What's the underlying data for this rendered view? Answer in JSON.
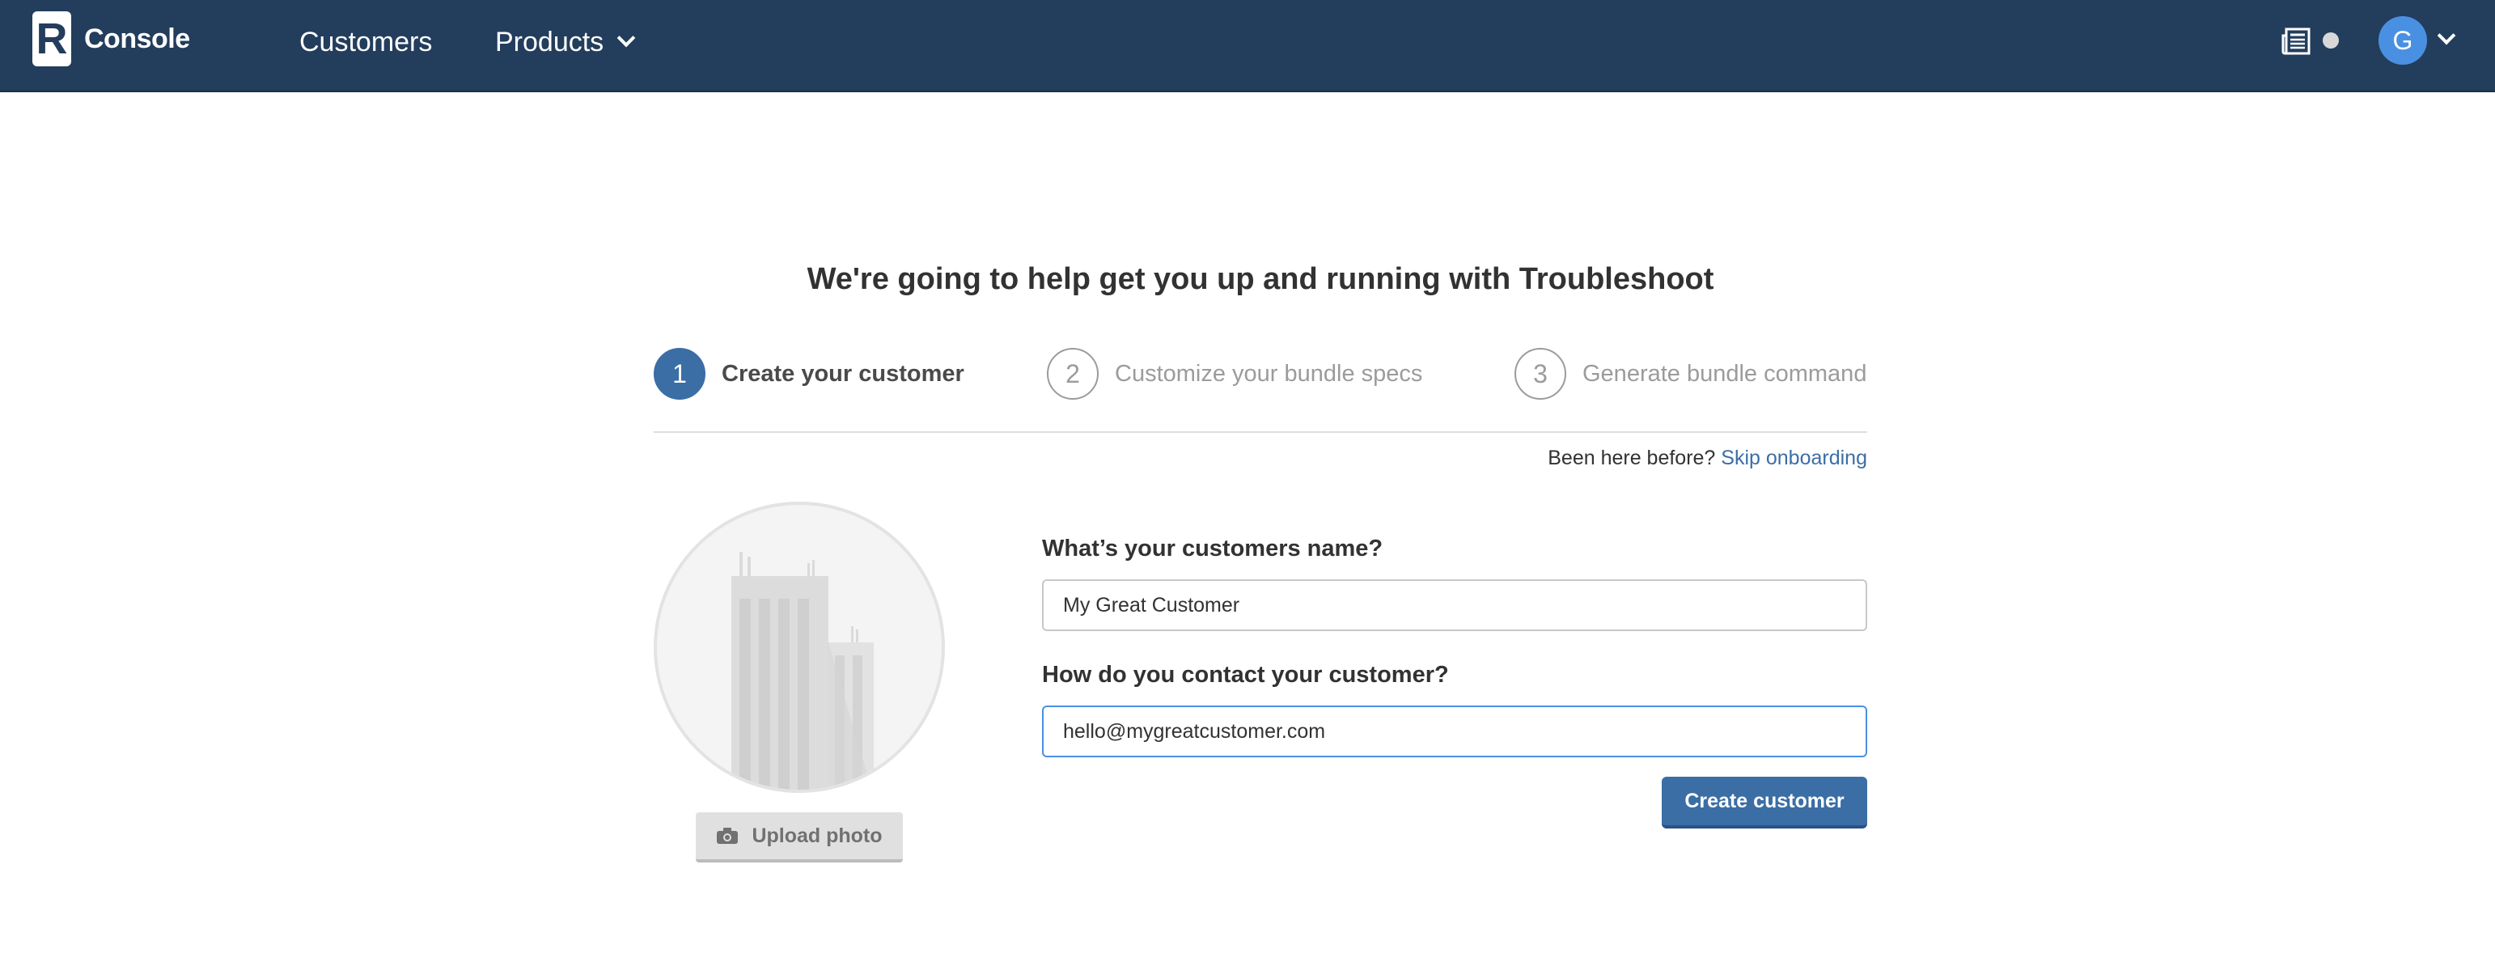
{
  "nav": {
    "brand_letter": "R",
    "brand_name": "Console",
    "customers_label": "Customers",
    "products_label": "Products",
    "avatar_initial": "G",
    "icons": {
      "news": "newspaper-icon",
      "dropdown": "chevron-down-icon"
    }
  },
  "onboarding": {
    "title": "We're going to help get you up and running with Troubleshoot",
    "steps": [
      {
        "number": "1",
        "label": "Create your customer",
        "active": true
      },
      {
        "number": "2",
        "label": "Customize your bundle specs",
        "active": false
      },
      {
        "number": "3",
        "label": "Generate bundle command",
        "active": false
      }
    ],
    "skip_prompt": "Been here before?",
    "skip_link": "Skip onboarding"
  },
  "form": {
    "name_label": "What’s your customers name?",
    "name_value": "My Great Customer",
    "contact_label": "How do you contact your customer?",
    "contact_value": "hello@mygreatcustomer.com",
    "upload_label": "Upload photo",
    "submit_label": "Create customer"
  },
  "colors": {
    "nav_bg": "#233d5c",
    "accent": "#3b6ea5",
    "avatar": "#4a90e2"
  }
}
